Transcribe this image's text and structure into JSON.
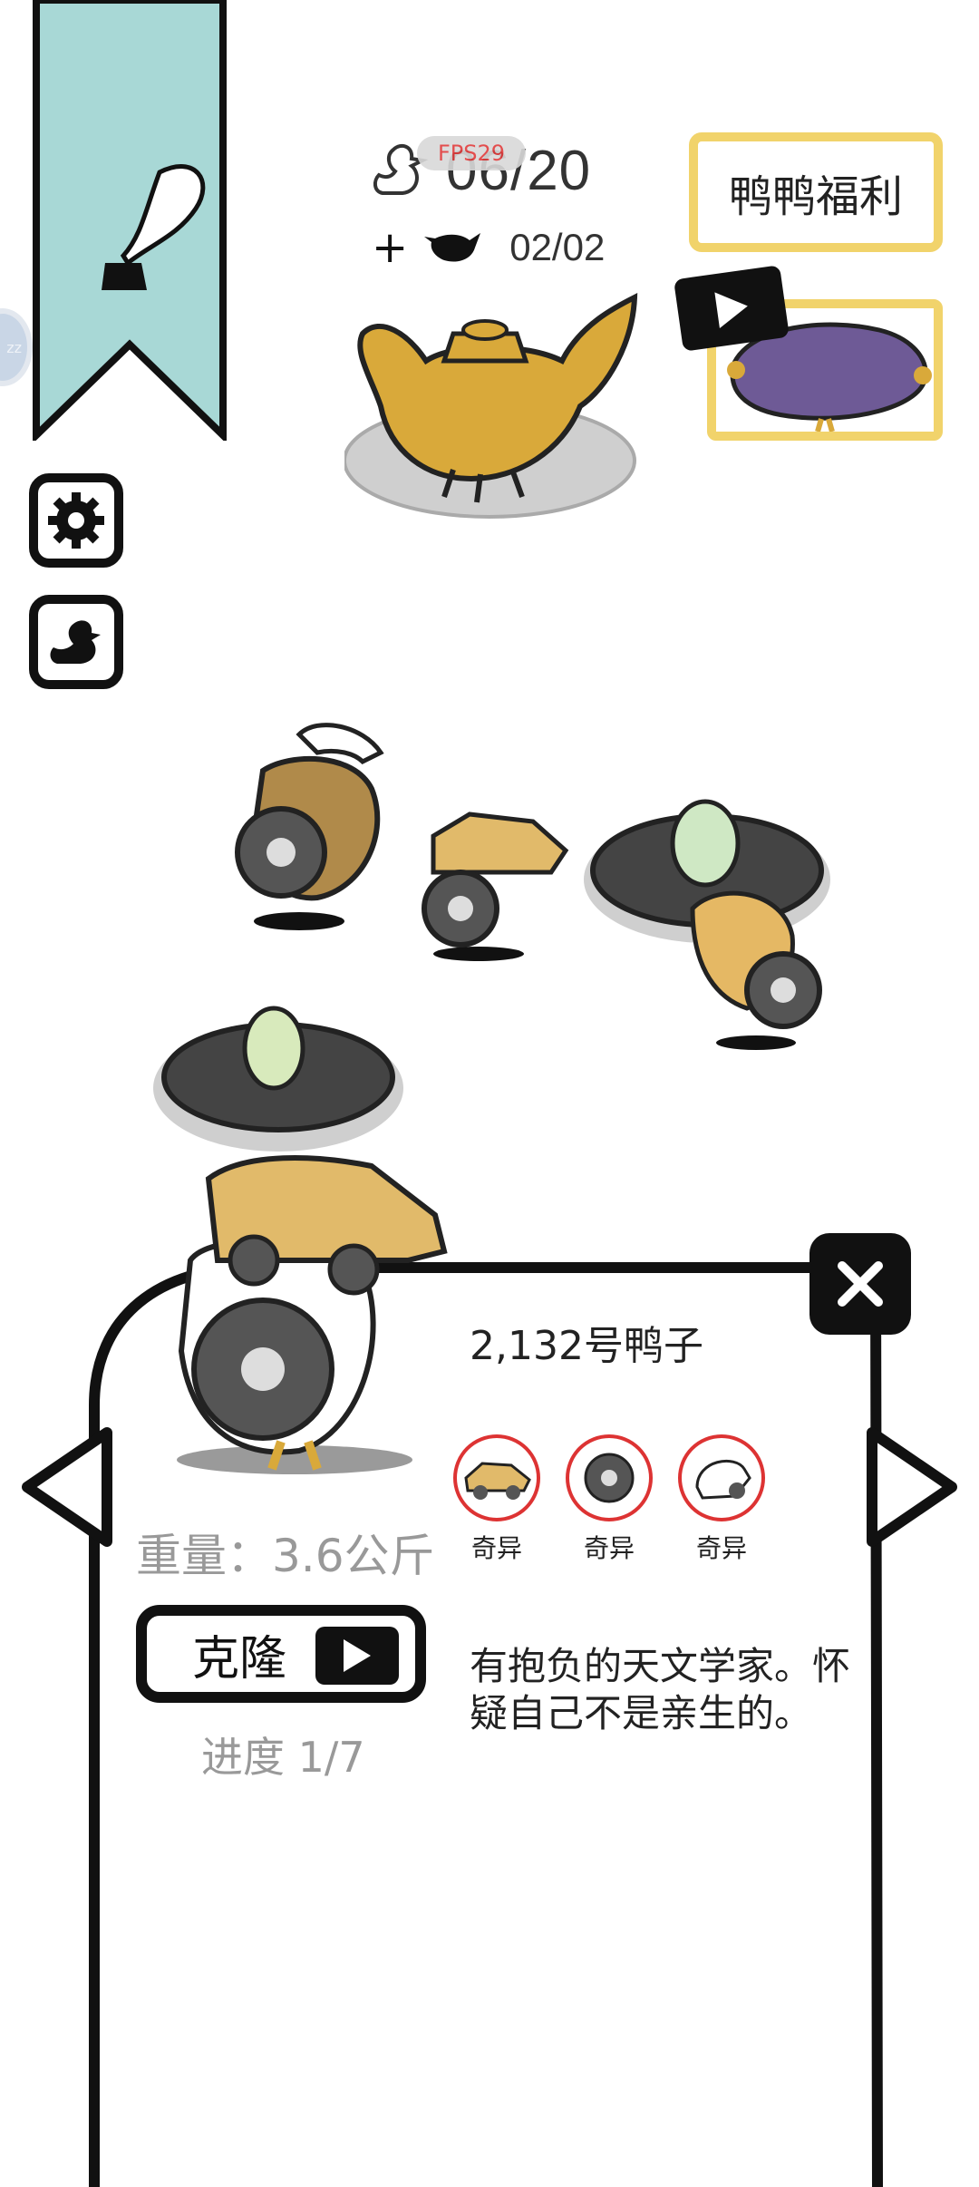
{
  "hud": {
    "fps_label": "FPS29",
    "duck_count": "06/20",
    "teapot_count": "02/02",
    "plus": "+"
  },
  "welfare": {
    "label": "鸭鸭福利"
  },
  "edge_bubble": {
    "text": "zz"
  },
  "card": {
    "duck_name": "2,132号鸭子",
    "traits": [
      {
        "name": "car-trait-icon",
        "label": "奇异"
      },
      {
        "name": "wheel-trait-icon",
        "label": "奇异"
      },
      {
        "name": "robe-trait-icon",
        "label": "奇异"
      }
    ],
    "weight": "重量：3.6公斤",
    "clone_label": "克隆",
    "progress": "进度 1/7",
    "description": "有抱负的天文学家。怀疑自己不是亲生的。"
  },
  "colors": {
    "ribbon": "#a8d8d6",
    "gold": "#d9a93a",
    "accent_yellow": "#f1d36b",
    "trait_ring": "#dd3333"
  }
}
